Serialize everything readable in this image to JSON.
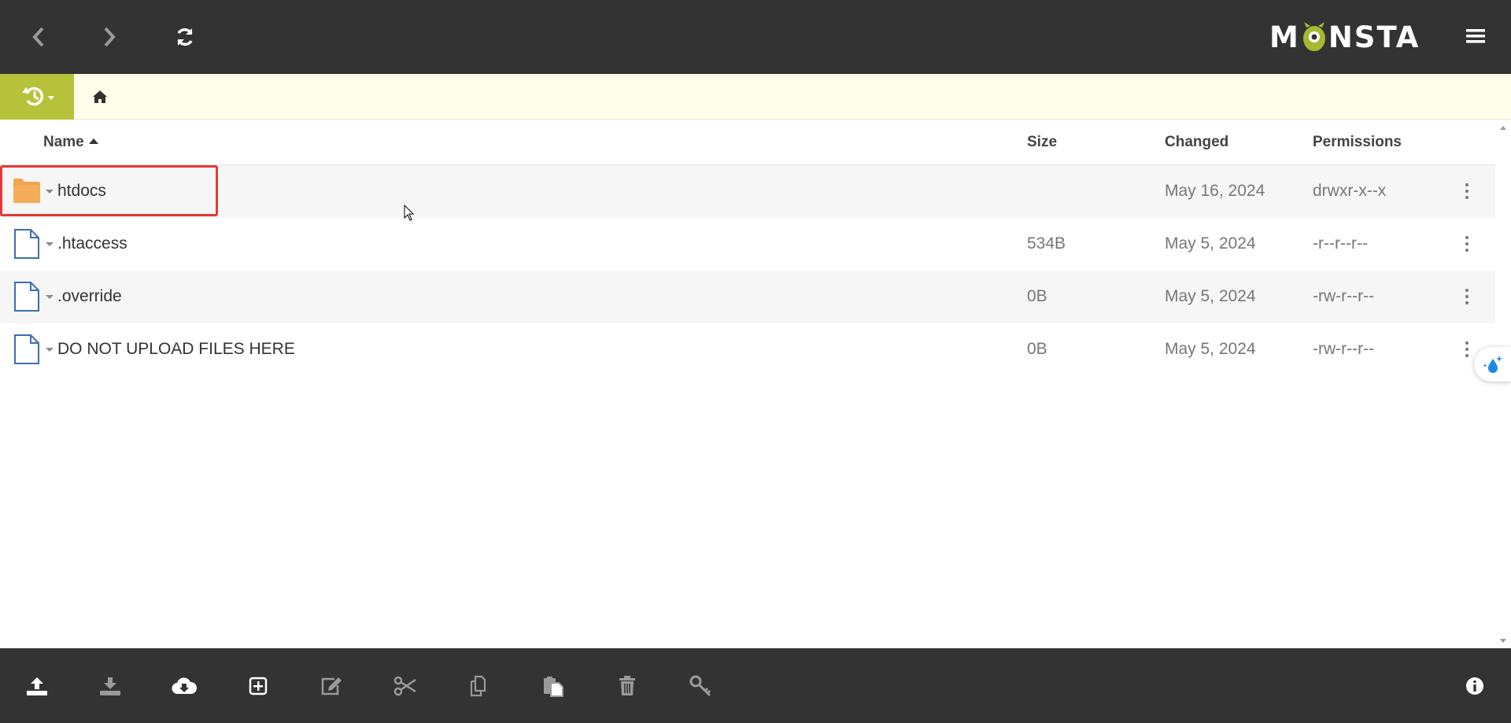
{
  "app": {
    "logo_text_left": "M",
    "logo_text_right": "NSTA",
    "logo_accent": "#a6b930"
  },
  "colors": {
    "topbar": "#333333",
    "history": "#b5c23a",
    "pathbar": "#fefde9",
    "highlight": "#e53935",
    "folder": "#f2a54a",
    "file": "#3a6fae"
  },
  "toolbar_top": {
    "back_icon": "chevron-left-icon",
    "forward_icon": "chevron-right-icon",
    "refresh_icon": "refresh-icon",
    "menu_icon": "hamburger-menu-icon"
  },
  "path": {
    "history_icon": "history-icon",
    "home_icon": "home-icon"
  },
  "table": {
    "headers": {
      "name": "Name",
      "size": "Size",
      "changed": "Changed",
      "permissions": "Permissions"
    },
    "sort": {
      "column": "Name",
      "direction": "ascending"
    },
    "rows": [
      {
        "type": "folder",
        "name": "htdocs",
        "size": "",
        "changed": "May 16, 2024",
        "permissions": "drwxr-x--x",
        "selected": true
      },
      {
        "type": "file",
        "name": ".htaccess",
        "size": "534B",
        "changed": "May 5, 2024",
        "permissions": "-r--r--r--",
        "selected": false
      },
      {
        "type": "file",
        "name": ".override",
        "size": "0B",
        "changed": "May 5, 2024",
        "permissions": "-rw-r--r--",
        "selected": false
      },
      {
        "type": "file",
        "name": "DO NOT UPLOAD FILES HERE",
        "size": "0B",
        "changed": "May 5, 2024",
        "permissions": "-rw-r--r--",
        "selected": false
      }
    ]
  },
  "toolbar_bottom": [
    "upload-icon",
    "download-icon",
    "fetch-cloud-icon",
    "new-item-icon",
    "edit-icon",
    "cut-icon",
    "copy-icon",
    "paste-icon",
    "delete-icon",
    "key-icon"
  ],
  "info_icon": "info-icon"
}
